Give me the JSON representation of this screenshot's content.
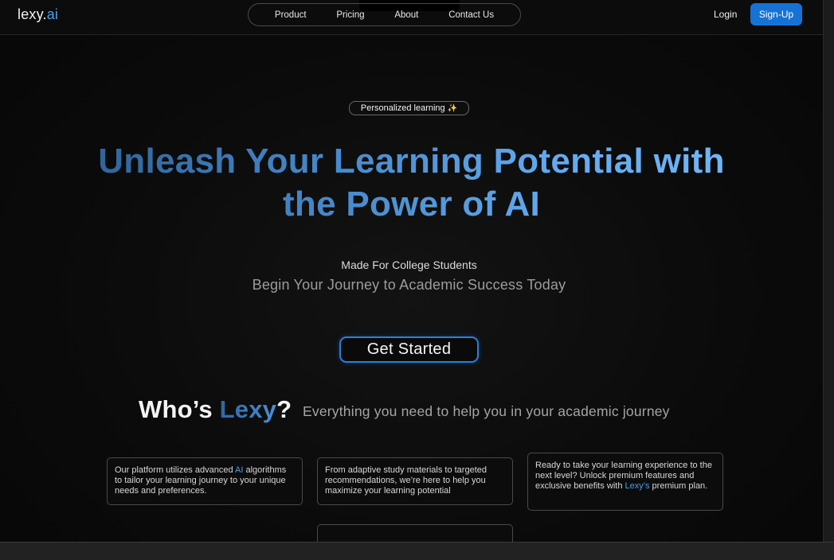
{
  "header": {
    "logo_main": "lexy.",
    "logo_ai": "ai",
    "nav": [
      "Product",
      "Pricing",
      "About",
      "Contact Us"
    ],
    "login": "Login",
    "signup": "Sign-Up"
  },
  "hero": {
    "badge": "Personalized learning",
    "badge_icon": "sparkles-icon",
    "title_line1": "Unleash Your Learning Potential with",
    "title_line2": "the Power of AI",
    "subtitle_1": "Made For College Students",
    "subtitle_2": "Begin Your Journey to Academic Success Today",
    "cta": "Get Started"
  },
  "about": {
    "heading_prefix": "Who’s ",
    "heading_name": "Lexy",
    "heading_suffix": "?",
    "tagline": "Everything you need to help you in your academic journey"
  },
  "cards": [
    {
      "before": "Our platform utilizes advanced ",
      "highlight": "AI",
      "after": " algorithms to tailor your learning journey to your unique needs and preferences."
    },
    {
      "before": "From adaptive study materials to targeted recommendations, we’re here to help you maximize your learning potential",
      "highlight": "",
      "after": ""
    },
    {
      "before": "Ready to take your learning experience to the next level? Unlock premium features and exclusive benefits with ",
      "highlight": "Lexy’s",
      "after": " premium plan."
    }
  ],
  "colors": {
    "accent": "#1673d6",
    "highlight": "#4a9eef",
    "background": "#0a0a0a"
  }
}
